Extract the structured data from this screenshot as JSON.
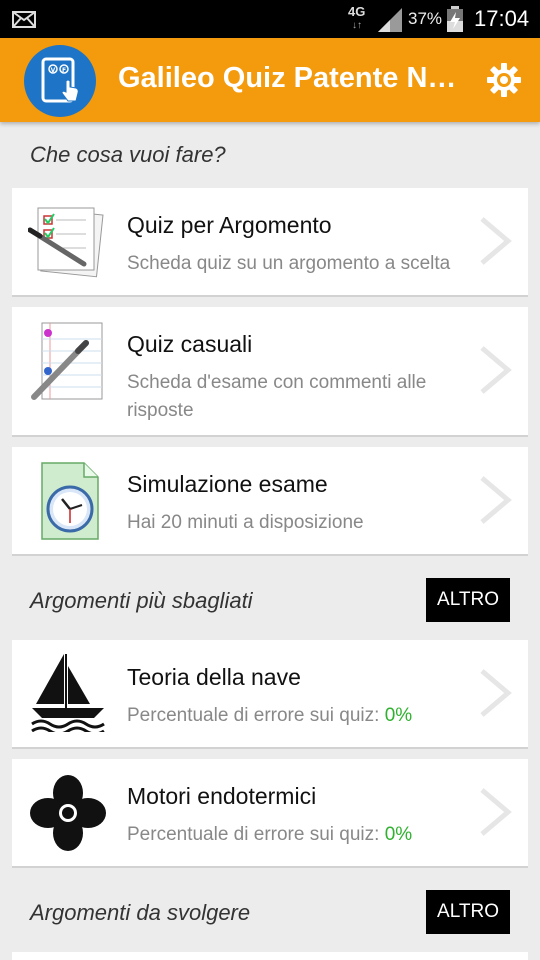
{
  "status_bar": {
    "network": "4G",
    "network_arrows": "↓↑",
    "battery_percent": "37%",
    "time": "17:04"
  },
  "toolbar": {
    "title": "Galileo Quiz Patente Nautica",
    "logo_text": "V F"
  },
  "sections": {
    "actions_title": "Che cosa vuoi fare?",
    "wrong_title": "Argomenti più sbagliati",
    "todo_title": "Argomenti da svolgere",
    "more_label": "ALTRO"
  },
  "actions": [
    {
      "title": "Quiz per Argomento",
      "subtitle": "Scheda quiz su un argomento a scelta"
    },
    {
      "title": "Quiz casuali",
      "subtitle": "Scheda d'esame con commenti alle risposte"
    },
    {
      "title": "Simulazione esame",
      "subtitle": "Hai 20 minuti a disposizione"
    }
  ],
  "wrong_topics": [
    {
      "title": "Teoria della nave",
      "subtitle": "Percentuale di errore sui quiz:",
      "percent": "0%"
    },
    {
      "title": "Motori endotermici",
      "subtitle": "Percentuale di errore sui quiz:",
      "percent": "0%"
    }
  ],
  "colors": {
    "accent": "#f39a0d",
    "logo_blue": "#1e74c6",
    "percent_green": "#2fb12f"
  },
  "icons": [
    "mail-icon",
    "signal-icon",
    "battery-icon",
    "settings-gear-icon",
    "checklist-pen-icon",
    "notepad-pen-icon",
    "document-clock-icon",
    "sailboat-icon",
    "propeller-icon",
    "chevron-right-icon"
  ]
}
